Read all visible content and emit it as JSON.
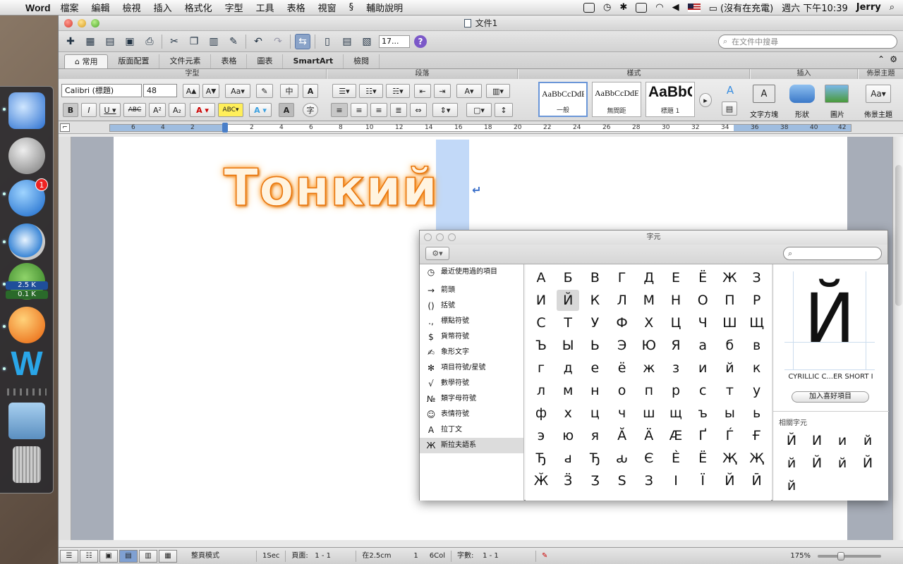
{
  "menubar": {
    "app_name": "Word",
    "items": [
      "檔案",
      "編輯",
      "檢視",
      "插入",
      "格式化",
      "字型",
      "工具",
      "表格",
      "視窗",
      "輔助說明"
    ],
    "battery": "(沒有在充電)",
    "clock": "週六 下午10:39",
    "user": "Jerry"
  },
  "dock": {
    "badge_appstore": "1",
    "torrent_up": "2.5 K",
    "torrent_down": "0.1 K"
  },
  "window": {
    "title": "文件1"
  },
  "toolbar": {
    "zoom": "17...",
    "search_placeholder": "在文件中搜尋"
  },
  "ribbon_tabs": [
    "常用",
    "版面配置",
    "文件元素",
    "表格",
    "圖表",
    "SmartArt",
    "檢閱"
  ],
  "ribbon": {
    "groups": {
      "font": "字型",
      "paragraph": "段落",
      "styles": "樣式",
      "insert": "插入",
      "theme": "佈景主題"
    },
    "font_name": "Calibri (標題)",
    "font_size": "48",
    "styles": [
      {
        "sample": "AaBbCcDdEe",
        "name": "一般"
      },
      {
        "sample": "AaBbCcDdEe",
        "name": "無間距"
      },
      {
        "sample": "AaBbC(",
        "name": "標題 1"
      }
    ],
    "insert_items": [
      "文字方塊",
      "形狀",
      "圖片"
    ],
    "theme_item": "佈景主題"
  },
  "ruler": {
    "ticks": [
      "6",
      "4",
      "2",
      "2",
      "4",
      "6",
      "8",
      "10",
      "12",
      "14",
      "16",
      "18",
      "20",
      "22",
      "24",
      "26",
      "28",
      "30",
      "32",
      "34",
      "36",
      "38",
      "40",
      "42"
    ]
  },
  "document": {
    "text": "Тонкий"
  },
  "statusbar": {
    "view_mode": "整頁模式",
    "sec": "1Sec",
    "page_label": "頁面:",
    "page_value": "1 - 1",
    "position": "在2.5cm",
    "line": "1",
    "col": "6Col",
    "words_label": "字數:",
    "words_value": "1 - 1",
    "zoom": "175%"
  },
  "charviewer": {
    "title": "字元",
    "categories": [
      {
        "icon": "clock-icon",
        "glyph": "◷",
        "label": "最近使用過的項目"
      },
      {
        "icon": "arrow-icon",
        "glyph": "→",
        "label": "箭頭"
      },
      {
        "icon": "parentheses-icon",
        "glyph": "()",
        "label": "括號"
      },
      {
        "icon": "punctuation-icon",
        "glyph": ".,",
        "label": "標點符號"
      },
      {
        "icon": "currency-icon",
        "glyph": "$",
        "label": "貨幣符號"
      },
      {
        "icon": "pictograph-icon",
        "glyph": "✍",
        "label": "象形文字"
      },
      {
        "icon": "bullet-star-icon",
        "glyph": "✻",
        "label": "項目符號/星號"
      },
      {
        "icon": "math-icon",
        "glyph": "√",
        "label": "數學符號"
      },
      {
        "icon": "letterlike-icon",
        "glyph": "№",
        "label": "類字母符號"
      },
      {
        "icon": "emoji-icon",
        "glyph": "☺",
        "label": "表情符號"
      },
      {
        "icon": "latin-icon",
        "glyph": "A",
        "label": "拉丁文"
      },
      {
        "icon": "cyrillic-icon",
        "glyph": "Ж",
        "label": "斯拉夫語系"
      }
    ],
    "glyph_rows": [
      [
        "А",
        "Б",
        "В",
        "Г",
        "Д",
        "Е",
        "Ё",
        "Ж",
        "З"
      ],
      [
        "И",
        "Й",
        "К",
        "Л",
        "М",
        "Н",
        "О",
        "П",
        "Р"
      ],
      [
        "С",
        "Т",
        "У",
        "Ф",
        "Х",
        "Ц",
        "Ч",
        "Ш",
        "Щ"
      ],
      [
        "Ъ",
        "Ы",
        "Ь",
        "Э",
        "Ю",
        "Я",
        "а",
        "б",
        "в"
      ],
      [
        "г",
        "д",
        "е",
        "ё",
        "ж",
        "з",
        "и",
        "й",
        "к"
      ],
      [
        "л",
        "м",
        "н",
        "о",
        "п",
        "р",
        "с",
        "т",
        "у"
      ],
      [
        "ф",
        "х",
        "ц",
        "ч",
        "ш",
        "щ",
        "ъ",
        "ы",
        "ь"
      ],
      [
        "э",
        "ю",
        "я",
        "Ӑ",
        "Ӓ",
        "Ӕ",
        "Ґ",
        "Ѓ",
        "Ғ"
      ],
      [
        "Ђ",
        "ԁ",
        "Ђ",
        "ԃ",
        "Є",
        "Ѐ",
        "Ё",
        "Җ",
        "Җ"
      ],
      [
        "Ӂ",
        "Ӟ",
        "Ӡ",
        "Ѕ",
        "З",
        "І",
        "Ї",
        "Й",
        "Ӣ"
      ]
    ],
    "preview_char": "Й",
    "char_name": "CYRILLIC C...ER SHORT I",
    "fav_button": "加入喜好項目",
    "related_label": "相關字元",
    "related": [
      "Й",
      "И",
      "и",
      "й",
      "й",
      "Й",
      "й",
      "Й",
      "й"
    ]
  }
}
